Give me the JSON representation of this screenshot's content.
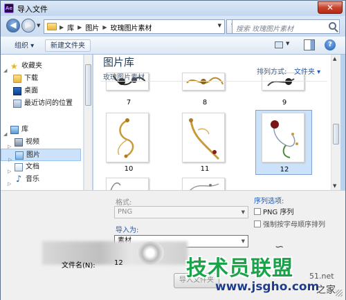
{
  "window": {
    "title": "导入文件",
    "app_icon_text": "Ae",
    "close_glyph": "✕"
  },
  "nav": {
    "back_glyph": "◀",
    "forward_glyph": "▶",
    "breadcrumb": [
      "库",
      "图片",
      "玫瑰图片素材"
    ],
    "search_placeholder": "搜索 玫瑰图片素材"
  },
  "toolbar": {
    "organize_label": "组织 ▾",
    "new_folder_label": "新建文件夹",
    "help_glyph": "?"
  },
  "sidebar": {
    "favorites_label": "收藏夹",
    "favorites": [
      {
        "label": "下载",
        "icon": "download-folder-icon"
      },
      {
        "label": "桌面",
        "icon": "desktop-icon"
      },
      {
        "label": "最近访问的位置",
        "icon": "recent-places-icon"
      }
    ],
    "libraries_label": "库",
    "libraries": [
      {
        "label": "视频",
        "icon": "video-library-icon",
        "selected": false
      },
      {
        "label": "图片",
        "icon": "pictures-library-icon",
        "selected": true
      },
      {
        "label": "文档",
        "icon": "documents-library-icon",
        "selected": false
      },
      {
        "label": "音乐",
        "icon": "music-library-icon",
        "selected": false
      }
    ]
  },
  "content": {
    "library_title": "图片库",
    "library_subtitle": "玫瑰图片素材",
    "arrange_label": "排列方式:",
    "arrange_value": "文件夹 ▾",
    "top_row_labels": [
      "7",
      "8",
      "9"
    ],
    "items": [
      {
        "label": "10",
        "selected": false
      },
      {
        "label": "11",
        "selected": false
      },
      {
        "label": "12",
        "selected": true
      }
    ]
  },
  "options": {
    "format_label": "格式:",
    "format_value": "PNG",
    "import_as_label": "导入为:",
    "import_as_value": "素材",
    "sequence_options_label": "序列选项:",
    "png_sequence_label": "PNG 序列",
    "force_alpha_label": "强制按字母顺序排列",
    "file_name_label": "文件名(N):",
    "file_name_value": "12",
    "import_button_label": "导入文件夹"
  },
  "watermark": {
    "main": "技术员联盟",
    "url": "www.jsgho.com",
    "site": "51.net",
    "home": "之家"
  }
}
